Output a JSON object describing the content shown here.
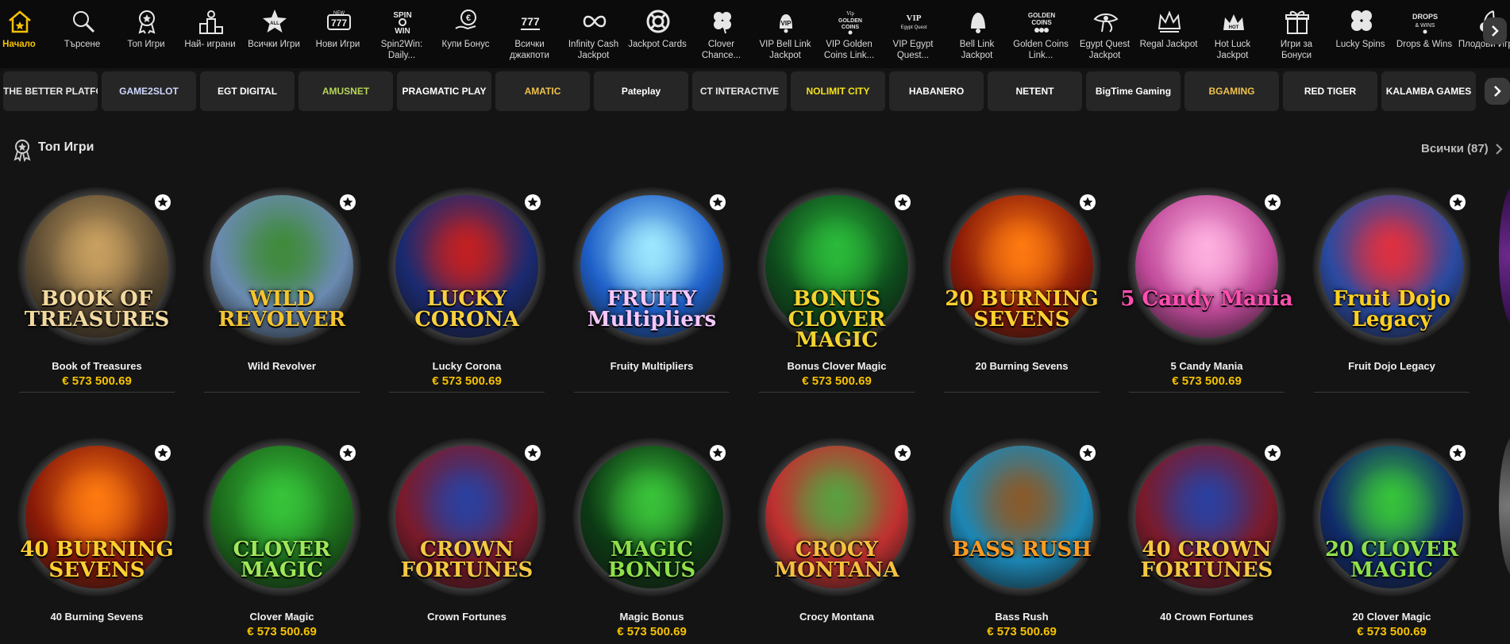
{
  "nav": {
    "items": [
      {
        "label": "Начало",
        "icon": "home-icon"
      },
      {
        "label": "Търсене",
        "icon": "search-icon"
      },
      {
        "label": "Топ Игри",
        "icon": "award-icon"
      },
      {
        "label": "Най- играни",
        "icon": "podium-icon"
      },
      {
        "label": "Всички Игри",
        "icon": "all-star-icon"
      },
      {
        "label": "Нови Игри",
        "icon": "777-new-icon"
      },
      {
        "label": "Spin2Win: Daily...",
        "icon": "spin2win-icon"
      },
      {
        "label": "Купи Бонус",
        "icon": "buy-bonus-icon"
      },
      {
        "label": "Всички джакпоти",
        "icon": "777-jackpot-icon"
      },
      {
        "label": "Infinity Cash Jackpot",
        "icon": "infinity-icon"
      },
      {
        "label": "Jackpot Cards",
        "icon": "lifebuoy-icon"
      },
      {
        "label": "Clover Chance...",
        "icon": "clover-icon"
      },
      {
        "label": "VIP Bell Link Jackpot",
        "icon": "vip-bell-icon"
      },
      {
        "label": "VIP Golden Coins Link...",
        "icon": "vip-golden-coins-icon"
      },
      {
        "label": "VIP Egypt Quest...",
        "icon": "vip-egypt-icon"
      },
      {
        "label": "Bell Link Jackpot",
        "icon": "bell-icon"
      },
      {
        "label": "Golden Coins Link...",
        "icon": "golden-coins-icon"
      },
      {
        "label": "Egypt Quest Jackpot",
        "icon": "eye-of-horus-icon"
      },
      {
        "label": "Regal Jackpot",
        "icon": "crown-icon"
      },
      {
        "label": "Hot Luck Jackpot",
        "icon": "hot-luck-crown-icon"
      },
      {
        "label": "Игри за Бонуси",
        "icon": "gift-icon"
      },
      {
        "label": "Lucky Spins",
        "icon": "lucky-clover-icon"
      },
      {
        "label": "Drops & Wins",
        "icon": "drops-wins-icon"
      },
      {
        "label": "Плодови Игри",
        "icon": "cherries-icon"
      }
    ]
  },
  "providers": [
    {
      "label": "THE BETTER PLATFORM",
      "color": "#e8e8e8"
    },
    {
      "label": "GAME2SLOT",
      "color": "#cfd8ff"
    },
    {
      "label": "EGT DIGITAL",
      "color": "#ffffff"
    },
    {
      "label": "AMUSNET",
      "color": "#b6d45a"
    },
    {
      "label": "PRAGMATIC PLAY",
      "color": "#ffffff"
    },
    {
      "label": "AMATIC",
      "color": "#f0c24a"
    },
    {
      "label": "Pateplay",
      "color": "#ffffff"
    },
    {
      "label": "CT INTERACTIVE",
      "color": "#e8e8e8"
    },
    {
      "label": "NOLIMIT CITY",
      "color": "#f7e21a"
    },
    {
      "label": "HABANERO",
      "color": "#ffffff"
    },
    {
      "label": "NETENT",
      "color": "#ffffff"
    },
    {
      "label": "BigTime Gaming",
      "color": "#ffffff"
    },
    {
      "label": "BGAMING",
      "color": "#f0c24a"
    },
    {
      "label": "RED TIGER",
      "color": "#ffffff"
    },
    {
      "label": "KALAMBA GAMES",
      "color": "#ffffff"
    }
  ],
  "section": {
    "title": "Топ Игри",
    "all_label": "Всички (87)"
  },
  "games_row1": [
    {
      "name": "Book of Treasures",
      "jackpot": "€ 573 500.69",
      "logo": "BOOK OF TREASURES",
      "bg": "#5a4a32",
      "accent": "#c9a060",
      "logo_color": "#f3d9a0"
    },
    {
      "name": "Wild Revolver",
      "jackpot": "",
      "logo": "WILD REVOLVER",
      "bg": "#6a8ab0",
      "accent": "#3f8a3a",
      "logo_color": "#f4c430"
    },
    {
      "name": "Lucky Corona",
      "jackpot": "€ 573 500.69",
      "logo": "LUCKY CORONA",
      "bg": "#1a2a70",
      "accent": "#c42020",
      "logo_color": "#f8d040"
    },
    {
      "name": "Fruity Multipliers",
      "jackpot": "",
      "logo": "FRUITY Multipliers",
      "bg": "#1e5fc8",
      "accent": "#9fe8ff",
      "logo_color": "#f7c7ff"
    },
    {
      "name": "Bonus Clover Magic",
      "jackpot": "€ 573 500.69",
      "logo": "BONUS CLOVER MAGIC",
      "bg": "#0e4a1c",
      "accent": "#2bbb3a",
      "logo_color": "#f3d330"
    },
    {
      "name": "20 Burning Sevens",
      "jackpot": "",
      "logo": "20 BURNING SEVENS",
      "bg": "#8a1a08",
      "accent": "#ff7a10",
      "logo_color": "#ffcf30"
    },
    {
      "name": "5 Candy Mania",
      "jackpot": "€ 573 500.69",
      "logo": "5 Candy Mania",
      "bg": "#c04a9a",
      "accent": "#ffb0e0",
      "logo_color": "#ff4fb0"
    },
    {
      "name": "Fruit Dojo Legacy",
      "jackpot": "",
      "logo": "Fruit Dojo Legacy",
      "bg": "#2a4aa0",
      "accent": "#e03040",
      "logo_color": "#ffd020"
    }
  ],
  "games_row2": [
    {
      "name": "40 Burning Sevens",
      "jackpot": "",
      "logo": "40 BURNING SEVENS",
      "bg": "#8a1a08",
      "accent": "#ff7a10",
      "logo_color": "#ffcf30"
    },
    {
      "name": "Clover Magic",
      "jackpot": "€ 573 500.69",
      "logo": "CLOVER MAGIC",
      "bg": "#1c6a1c",
      "accent": "#37c43a",
      "logo_color": "#9fe85a"
    },
    {
      "name": "Crown Fortunes",
      "jackpot": "",
      "logo": "CROWN FORTUNES",
      "bg": "#7a1a2a",
      "accent": "#2a40a0",
      "logo_color": "#f5c842"
    },
    {
      "name": "Magic Bonus",
      "jackpot": "€ 573 500.69",
      "logo": "MAGIC BONUS",
      "bg": "#0c3a14",
      "accent": "#3ac43a",
      "logo_color": "#8ee04a"
    },
    {
      "name": "Crocy Montana",
      "jackpot": "",
      "logo": "CROCY MONTANA",
      "bg": "#c03030",
      "accent": "#5aa040",
      "logo_color": "#f6c040"
    },
    {
      "name": "Bass Rush",
      "jackpot": "€ 573 500.69",
      "logo": "BASS RUSH",
      "bg": "#1c86b4",
      "accent": "#8a5a2a",
      "logo_color": "#ff9a20"
    },
    {
      "name": "40 Crown Fortunes",
      "jackpot": "",
      "logo": "40 CROWN FORTUNES",
      "bg": "#7a1a2a",
      "accent": "#2a40a0",
      "logo_color": "#f5c842"
    },
    {
      "name": "20 Clover Magic",
      "jackpot": "€ 573 500.69",
      "logo": "20 CLOVER MAGIC",
      "bg": "#102a6a",
      "accent": "#37c43a",
      "logo_color": "#8ee04a"
    }
  ],
  "colors": {
    "accent_yellow": "#f6c200",
    "background": "#141414",
    "nav_background": "#0b0b0b",
    "provider_tile": "#262626"
  }
}
